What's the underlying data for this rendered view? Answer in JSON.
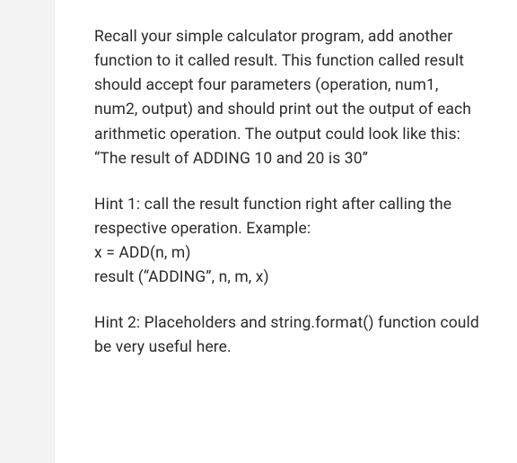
{
  "content": {
    "paragraphs": [
      "Recall your simple calculator program, add another function to it called result. This function called result should accept four parameters (operation, num1, num2, output) and should print out the output of each arithmetic operation. The output could look like this: “The result of ADDING 10 and 20 is 30”",
      "Hint 1: call the result function right after calling the respective operation. Example:\nx = ADD(n, m)\nresult (“ADDING”, n, m, x)",
      "Hint 2: Placeholders and string.format() function could be very useful here."
    ]
  }
}
